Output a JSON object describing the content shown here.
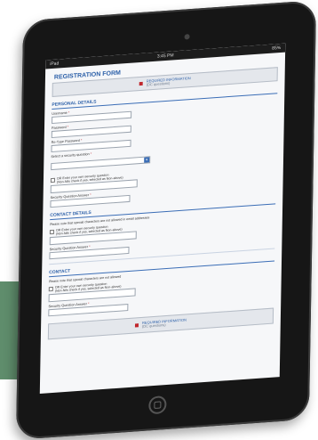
{
  "status": {
    "carrier": "iPad",
    "time": "3:45 PM",
    "battery": "85%"
  },
  "form": {
    "title": "REGISTRATION FORM",
    "required_text": "REQUIRED INFORMATION",
    "required_sub": "(DC questions)",
    "sections": {
      "personal": {
        "title": "PERSONAL DETAILS",
        "username": "Username",
        "password": "Password",
        "retype": "Re-Type Password",
        "security_question": "Select a security question",
        "checkbox_text": "OR Enter your own security question",
        "checkbox_sub": "(Non-Nils check if yes, selected as Non-above)",
        "security_answer": "Security Question Answer"
      },
      "contact_details": {
        "title": "CONTACT DETAILS",
        "note": "Please note that special characters are not allowed in email addresses",
        "checkbox_text": "OR Enter your own security question",
        "checkbox_sub": "(Non-Nils check if yes, selected as Non-above)",
        "security_answer": "Security Question Answer"
      },
      "contact": {
        "title": "CONTACT",
        "note": "Please note that special characters are not allowed",
        "checkbox_text": "OR Enter your own security question",
        "checkbox_sub": "(Non-Nils check if yes, selected as Non-above)",
        "security_answer": "Security Question Answer"
      }
    },
    "required_star": "*"
  }
}
